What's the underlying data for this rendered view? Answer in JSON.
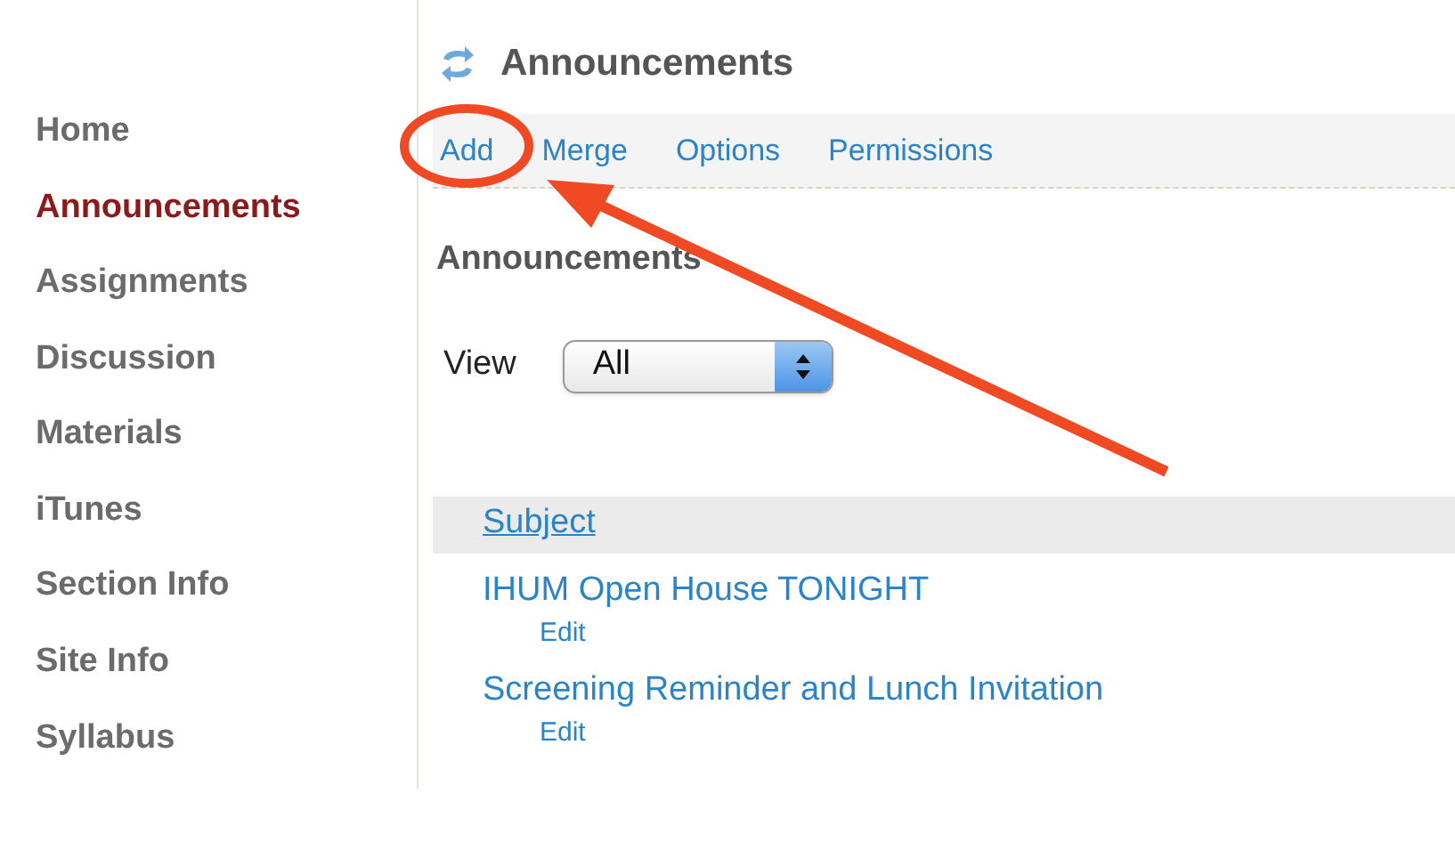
{
  "sidebar": {
    "items": [
      {
        "label": "Home",
        "selected": false
      },
      {
        "label": "Announcements",
        "selected": true
      },
      {
        "label": "Assignments",
        "selected": false
      },
      {
        "label": "Discussion",
        "selected": false
      },
      {
        "label": "Materials",
        "selected": false
      },
      {
        "label": "iTunes",
        "selected": false
      },
      {
        "label": "Section Info",
        "selected": false
      },
      {
        "label": "Site Info",
        "selected": false
      },
      {
        "label": "Syllabus",
        "selected": false
      }
    ]
  },
  "page_title": "Announcements",
  "toolbar": [
    "Add",
    "Merge",
    "Options",
    "Permissions"
  ],
  "heading": "Announcements",
  "view_filter": {
    "label": "View",
    "value": "All"
  },
  "table": {
    "columns": [
      "Subject"
    ],
    "rows": [
      {
        "subject": "IHUM Open House TONIGHT",
        "action": "Edit"
      },
      {
        "subject": "Screening Reminder and Lunch Invitation",
        "action": "Edit"
      }
    ]
  }
}
